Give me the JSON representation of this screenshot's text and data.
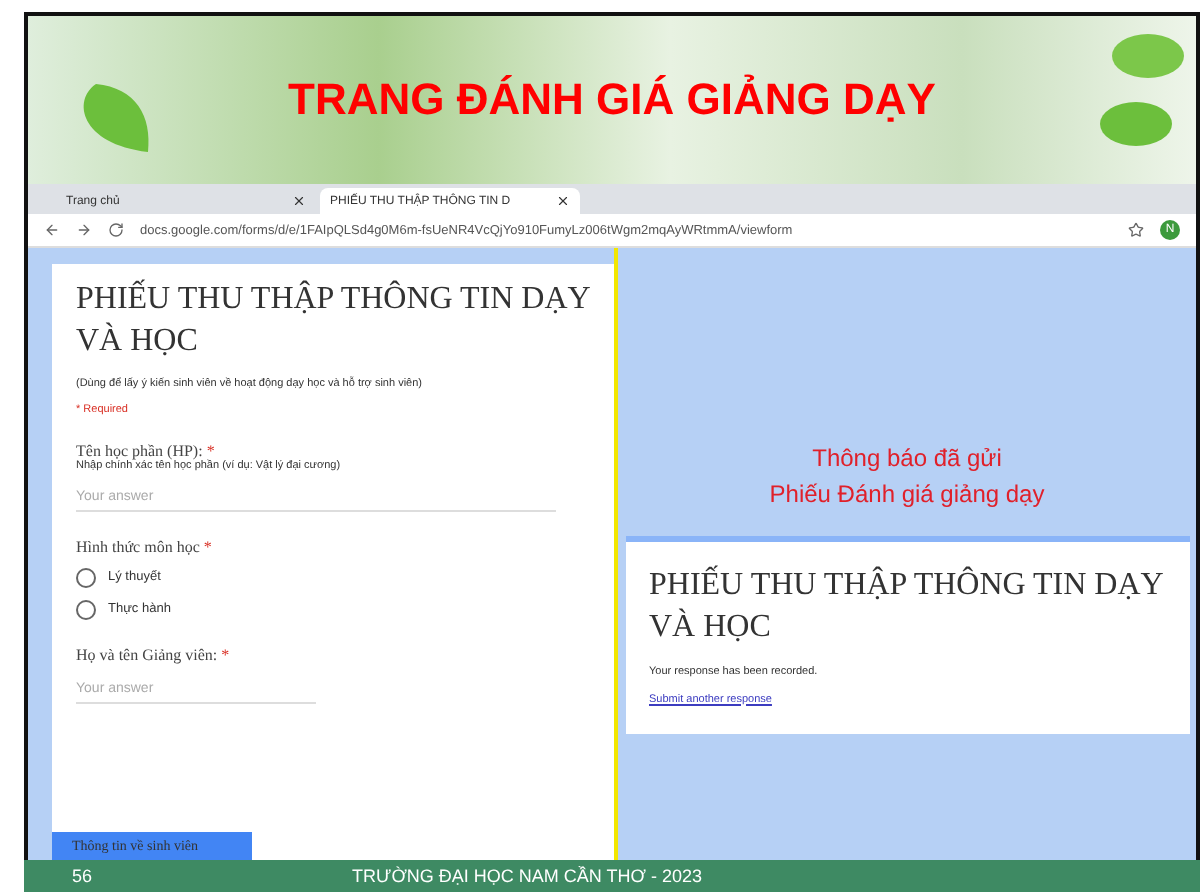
{
  "slide_title": "TRANG ĐÁNH GIÁ GIẢNG DẠY",
  "browser": {
    "tabs": [
      {
        "label": "Trang chủ",
        "selected": false
      },
      {
        "label": "PHIẾU THU THẬP THÔNG TIN D",
        "selected": true
      }
    ],
    "address": "docs.google.com/forms/d/e/1FAIpQLSd4g0M6m-fsUeNR4VcQjYo910FumyLz006tWgm2mqAyWRtmmA/viewform",
    "profile": "N"
  },
  "form": {
    "title": "PHIẾU THU THẬP THÔNG TIN DẠY VÀ HỌC",
    "description": "(Dùng để lấy ý kiến sinh viên về hoạt động dạy học và hỗ trợ sinh viên)",
    "required_note": "* Required",
    "questions": [
      {
        "kind": "text",
        "label": "Tên học phần (HP):",
        "required_mark": "*",
        "hint": "Nhập chính xác tên học phần (ví dụ: Vật lý đại cương)",
        "placeholder": "Your answer"
      },
      {
        "kind": "radio",
        "label": "Hình thức môn học",
        "required_mark": "*",
        "options": [
          {
            "label": "Lý thuyết",
            "selected": false
          },
          {
            "label": "Thực hành",
            "selected": false
          }
        ]
      },
      {
        "kind": "text",
        "label": "Họ và tên Giảng viên:",
        "required_mark": "*",
        "placeholder": "Your answer"
      }
    ],
    "section": "Thông tin về sinh viên"
  },
  "callout": [
    "Thông báo đã gửi",
    "Phiếu Đánh giá giảng dạy"
  ],
  "confirmation": {
    "title": "PHIẾU THU THẬP THÔNG TIN DẠY VÀ HỌC",
    "message": "Your response has been recorded.",
    "link": "Submit another response"
  },
  "footer": {
    "page": "56",
    "text": "TRƯỜNG ĐẠI HỌC NAM CẦN THƠ - 2023"
  }
}
